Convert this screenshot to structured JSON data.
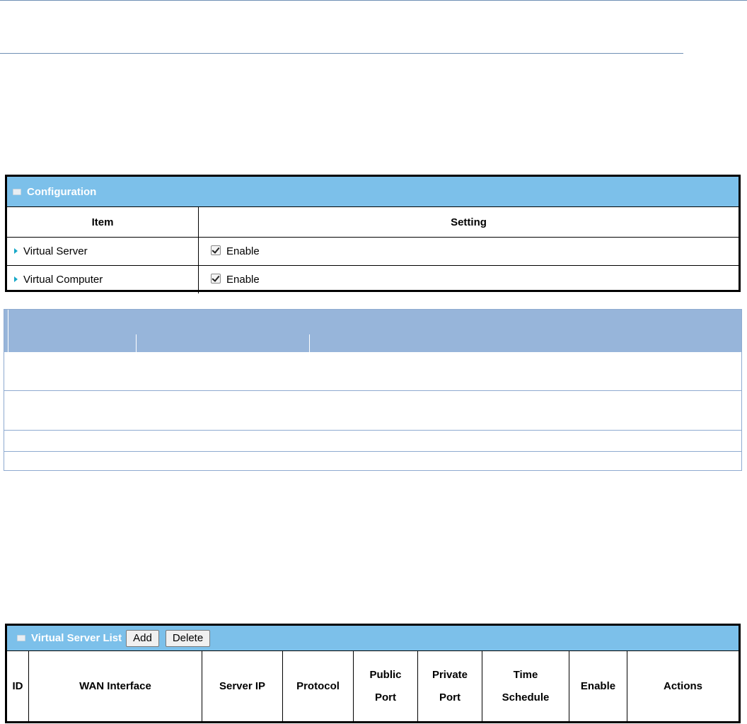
{
  "configuration": {
    "title": "Configuration",
    "columns": {
      "item": "Item",
      "setting": "Setting"
    },
    "rows": [
      {
        "item": "Virtual Server",
        "setting": "Enable",
        "checked": true
      },
      {
        "item": "Virtual Computer",
        "setting": "Enable",
        "checked": true
      }
    ]
  },
  "virtual_server_list": {
    "title": "Virtual Server List",
    "add_label": "Add",
    "delete_label": "Delete",
    "columns": {
      "id": "ID",
      "wan_interface": "WAN Interface",
      "server_ip": "Server IP",
      "protocol": "Protocol",
      "public_port_1": "Public",
      "public_port_2": "Port",
      "private_port_1": "Private",
      "private_port_2": "Port",
      "time_schedule_1": "Time",
      "time_schedule_2": "Schedule",
      "enable": "Enable",
      "actions": "Actions"
    }
  },
  "colors": {
    "header_blue": "#7cc0ea",
    "table_header_blue": "#97b5da",
    "arrow": "#18a8c8"
  }
}
